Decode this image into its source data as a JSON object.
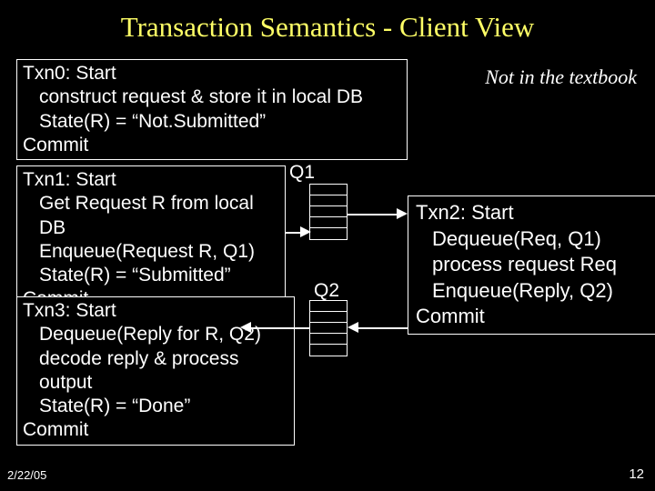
{
  "title": "Transaction Semantics - Client View",
  "note": "Not in the textbook",
  "footer": {
    "date": "2/22/05",
    "page": "12"
  },
  "queues": {
    "q1": "Q1",
    "q2": "Q2"
  },
  "txn0": {
    "l1": "Txn0: Start",
    "l2": "construct request & store it in local DB",
    "l3": "State(R) = “Not.Submitted”",
    "l4": "Commit"
  },
  "txn1": {
    "l1": "Txn1: Start",
    "l2": "Get Request R from local DB",
    "l3": "Enqueue(Request R, Q1)",
    "l4": "State(R) = “Submitted”",
    "l5": "Commit"
  },
  "txn2": {
    "l1": "Txn2: Start",
    "l2": "Dequeue(Req, Q1)",
    "l3": "process request Req",
    "l4": "Enqueue(Reply, Q2)",
    "l5": "Commit"
  },
  "txn3": {
    "l1": "Txn3: Start",
    "l2": "Dequeue(Reply for R, Q2)",
    "l3": "decode reply & process output",
    "l4": "State(R) = “Done”",
    "l5": "Commit"
  }
}
